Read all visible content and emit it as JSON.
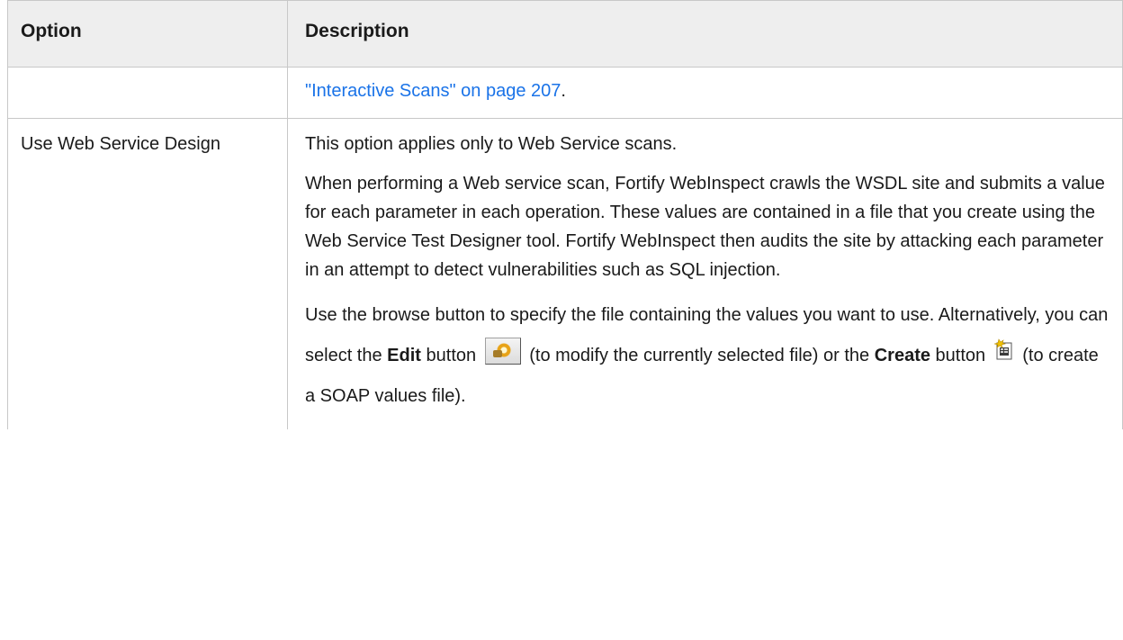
{
  "table": {
    "headers": {
      "option": "Option",
      "description": "Description"
    },
    "continued_row": {
      "link_text": "\"Interactive Scans\" on page 207",
      "trailing": "."
    },
    "row": {
      "option": "Use Web Service Design",
      "para1": "This option applies only to Web Service scans.",
      "para2": "When performing a Web service scan, Fortify WebInspect crawls the WSDL site and submits a value for each parameter in each operation. These values are contained in a file that you create using the Web Service Test Designer tool. Fortify WebInspect then audits the site by attacking each parameter in an attempt to detect vulnerabilities such as SQL injection.",
      "para3": {
        "text1": "Use the browse button to specify the file containing the values you want to use. Alternatively, you can select the ",
        "edit_label": "Edit",
        "text2": " button ",
        "text3": " (to modify the currently selected file) or the ",
        "create_label": "Create",
        "text4": " button ",
        "text5": " (to create a SOAP values file)."
      }
    }
  },
  "icons": {
    "edit": "edit-gear-icon",
    "create": "create-file-icon"
  }
}
